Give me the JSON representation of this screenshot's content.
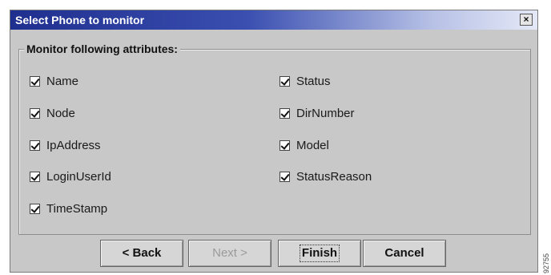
{
  "window": {
    "title": "Select Phone to monitor",
    "close_glyph": "×"
  },
  "group": {
    "legend": "Monitor following attributes:"
  },
  "attributes": [
    {
      "label": "Name",
      "checked": true
    },
    {
      "label": "Node",
      "checked": true
    },
    {
      "label": "IpAddress",
      "checked": true
    },
    {
      "label": "LoginUserId",
      "checked": true
    },
    {
      "label": "TimeStamp",
      "checked": true
    },
    {
      "label": "Status",
      "checked": true
    },
    {
      "label": "DirNumber",
      "checked": true
    },
    {
      "label": "Model",
      "checked": true
    },
    {
      "label": "StatusReason",
      "checked": true
    }
  ],
  "buttons": {
    "back": "< Back",
    "next": "Next >",
    "finish": "Finish",
    "cancel": "Cancel"
  },
  "side_mark": "92755",
  "colors": {
    "dialog_bg": "#c8c8c8",
    "title_start": "#1f2f8f",
    "title_end": "#e4e8f6"
  }
}
